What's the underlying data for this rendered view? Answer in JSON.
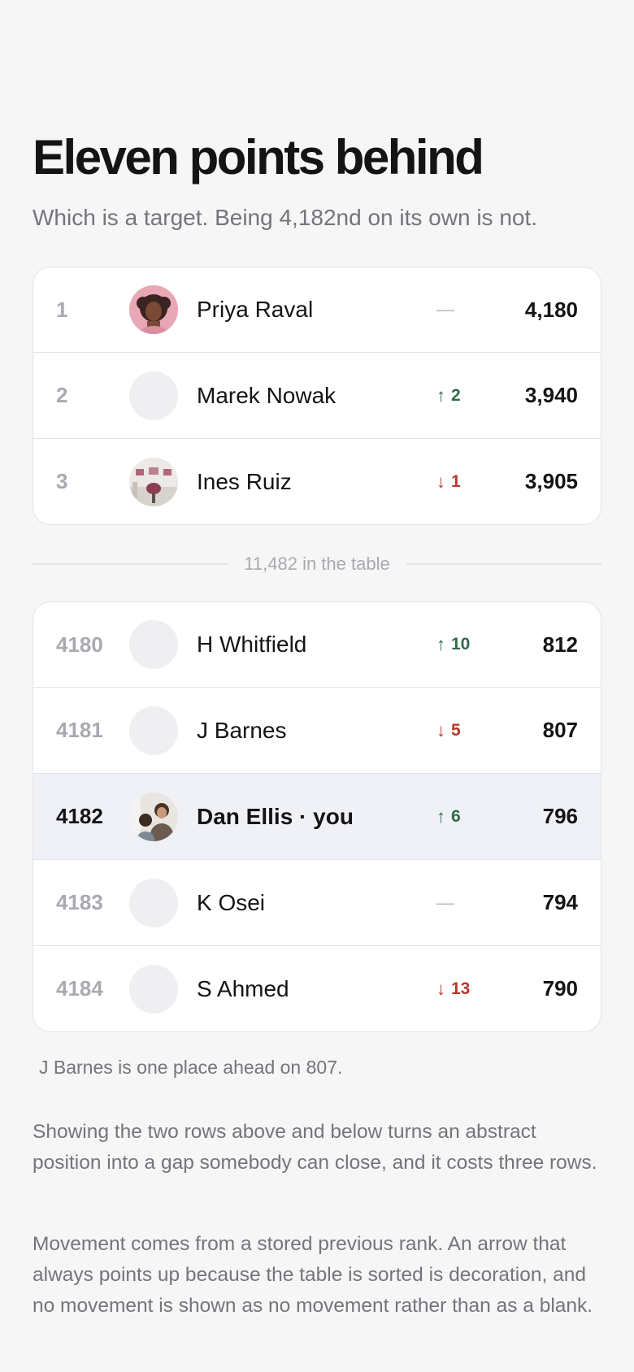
{
  "header": {
    "title": "Eleven points behind",
    "subtitle": "Which is a target. Being 4,182nd on its own is not."
  },
  "top_rows": [
    {
      "rank": "1",
      "name": "Priya Raval",
      "movement": "",
      "movement_dir": "none",
      "movement_symbol": "—",
      "score": "4,180",
      "avatar": "photo-portrait-avatar"
    },
    {
      "rank": "2",
      "name": "Marek Nowak",
      "movement": "2",
      "movement_dir": "up",
      "movement_symbol": "↑",
      "score": "3,940",
      "avatar": "blank-avatar"
    },
    {
      "rank": "3",
      "name": "Ines Ruiz",
      "movement": "1",
      "movement_dir": "down",
      "movement_symbol": "↓",
      "score": "3,905",
      "avatar": "photo-interior-avatar"
    }
  ],
  "divider": {
    "label": "11,482 in the table"
  },
  "around_rows": [
    {
      "rank": "4180",
      "name": "H Whitfield",
      "movement": "10",
      "movement_dir": "up",
      "movement_symbol": "↑",
      "score": "812",
      "avatar": "blank-avatar"
    },
    {
      "rank": "4181",
      "name": "J Barnes",
      "movement": "5",
      "movement_dir": "down",
      "movement_symbol": "↓",
      "score": "807",
      "avatar": "blank-avatar"
    },
    {
      "rank": "4182",
      "name": "Dan Ellis · you",
      "movement": "6",
      "movement_dir": "up",
      "movement_symbol": "↑",
      "score": "796",
      "avatar": "photo-people-avatar",
      "is_you": true
    },
    {
      "rank": "4183",
      "name": "K Osei",
      "movement": "",
      "movement_dir": "none",
      "movement_symbol": "—",
      "score": "794",
      "avatar": "blank-avatar"
    },
    {
      "rank": "4184",
      "name": "S Ahmed",
      "movement": "13",
      "movement_dir": "down",
      "movement_symbol": "↓",
      "score": "790",
      "avatar": "blank-avatar"
    }
  ],
  "note": "J Barnes is one place ahead on 807.",
  "paragraphs": [
    "Showing the two rows above and below turns an abstract position into a gap somebody can close, and it costs three rows.",
    "Movement comes from a stored previous rank. An arrow that always points up because the table is sorted is decoration, and no movement is shown as no movement rather than as a blank."
  ],
  "colors": {
    "background": "#f6f6f7",
    "card": "#ffffff",
    "up": "#2f6b49",
    "down": "#b23a2b",
    "highlight_row": "#f0f0f7",
    "muted_text": "#74747c"
  }
}
